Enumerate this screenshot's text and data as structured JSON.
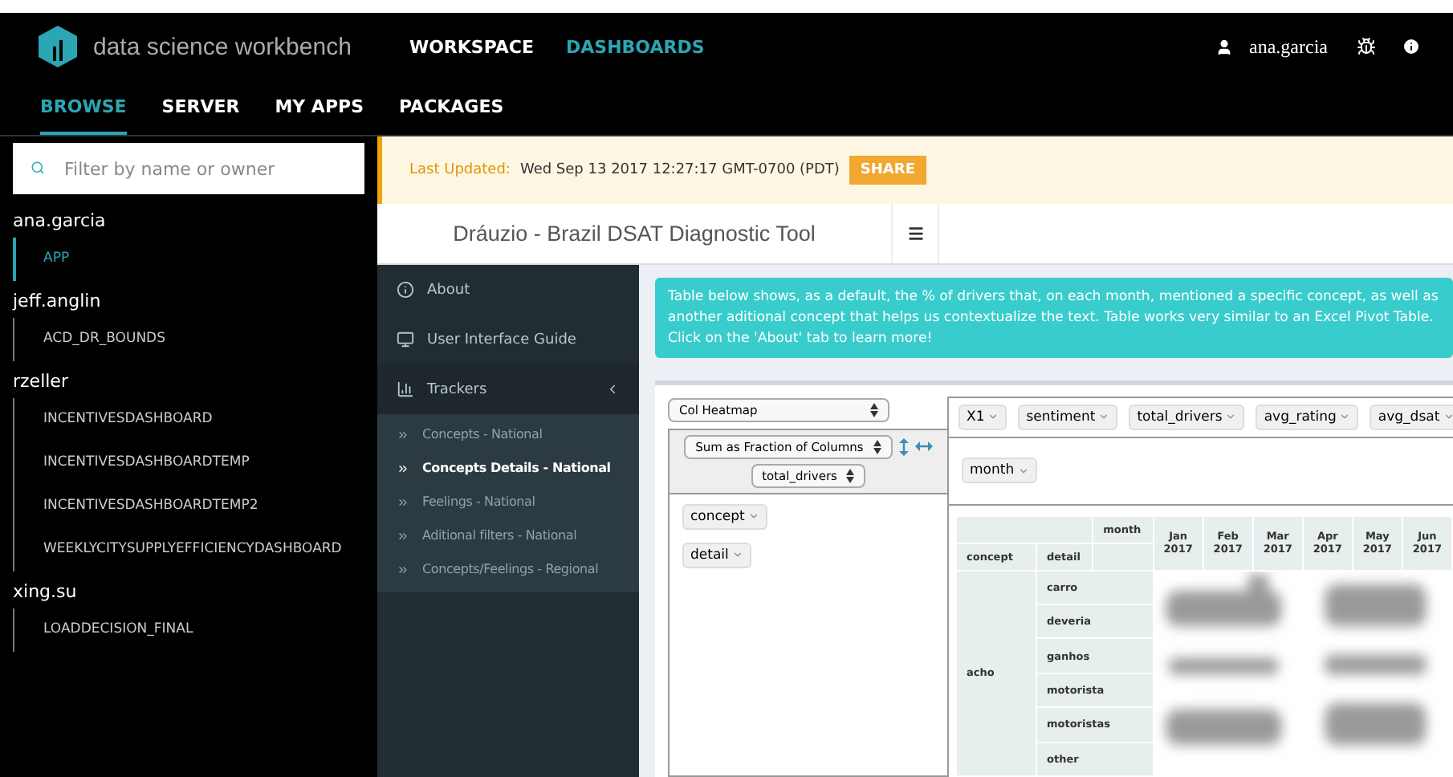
{
  "brand": {
    "name": "data science workbench"
  },
  "top_nav": [
    {
      "label": "WORKSPACE",
      "selected": false
    },
    {
      "label": "DASHBOARDS",
      "selected": true
    }
  ],
  "user": {
    "name": "ana.garcia"
  },
  "sub_nav": [
    {
      "label": "BROWSE",
      "selected": true
    },
    {
      "label": "SERVER",
      "selected": false
    },
    {
      "label": "MY APPS",
      "selected": false
    },
    {
      "label": "PACKAGES",
      "selected": false
    }
  ],
  "search": {
    "placeholder": "Filter by name or owner"
  },
  "owners": [
    {
      "name": "ana.garcia",
      "apps": [
        {
          "name": "APP",
          "selected": true
        }
      ]
    },
    {
      "name": "jeff.anglin",
      "apps": [
        {
          "name": "ACD_DR_BOUNDS",
          "selected": false
        }
      ]
    },
    {
      "name": "rzeller",
      "apps": [
        {
          "name": "INCENTIVESDASHBOARD",
          "selected": false
        },
        {
          "name": "INCENTIVESDASHBOARDTEMP",
          "selected": false
        },
        {
          "name": "INCENTIVESDASHBOARDTEMP2",
          "selected": false
        },
        {
          "name": "WEEKLYCITYSUPPLYEFFICIENCYDASHBOARD",
          "selected": false
        }
      ]
    },
    {
      "name": "xing.su",
      "apps": [
        {
          "name": "LOADDECISION_FINAL",
          "selected": false
        }
      ]
    }
  ],
  "banner": {
    "label": "Last Updated:",
    "text": "Wed Sep 13 2017 12:27:17 GMT-0700 (PDT)",
    "button": "SHARE"
  },
  "app": {
    "title": "Dráuzio - Brazil DSAT Diagnostic Tool",
    "menu": [
      {
        "label": "About",
        "kind": "info"
      },
      {
        "label": "User Interface Guide",
        "kind": "window"
      },
      {
        "label": "Trackers",
        "kind": "chart",
        "expanded": true,
        "children": [
          {
            "label": "Concepts - National",
            "selected": false
          },
          {
            "label": "Concepts Details - National",
            "selected": true
          },
          {
            "label": "Feelings - National",
            "selected": false
          },
          {
            "label": "Aditional filters - National",
            "selected": false
          },
          {
            "label": "Concepts/Feelings - Regional",
            "selected": false
          }
        ]
      }
    ],
    "callout": "Table below shows, as a default, the % of drivers that, on each month, mentioned a specific concept, as well as another aditional concept that helps us contextualize the text. Table works very similar to an Excel Pivot Table. Click on the 'About' tab to learn more!"
  },
  "pivot": {
    "renderer": "Col Heatmap",
    "aggregator": "Sum as Fraction of Columns",
    "value_field": "total_drivers",
    "unused_fields": [
      "X1",
      "sentiment",
      "total_drivers",
      "avg_rating",
      "avg_dsat"
    ],
    "col_fields": [
      "month"
    ],
    "row_fields": [
      "concept",
      "detail"
    ],
    "table": {
      "col_label": "month",
      "row_labels": [
        "concept",
        "detail"
      ],
      "columns": [
        [
          "Jan",
          "2017"
        ],
        [
          "Feb",
          "2017"
        ],
        [
          "Mar",
          "2017"
        ],
        [
          "Apr",
          "2017"
        ],
        [
          "May",
          "2017"
        ],
        [
          "Jun",
          "2017"
        ]
      ],
      "group": "acho",
      "details": [
        "carro",
        "deveria",
        "ganhos",
        "motorista",
        "motoristas",
        "other"
      ]
    }
  }
}
